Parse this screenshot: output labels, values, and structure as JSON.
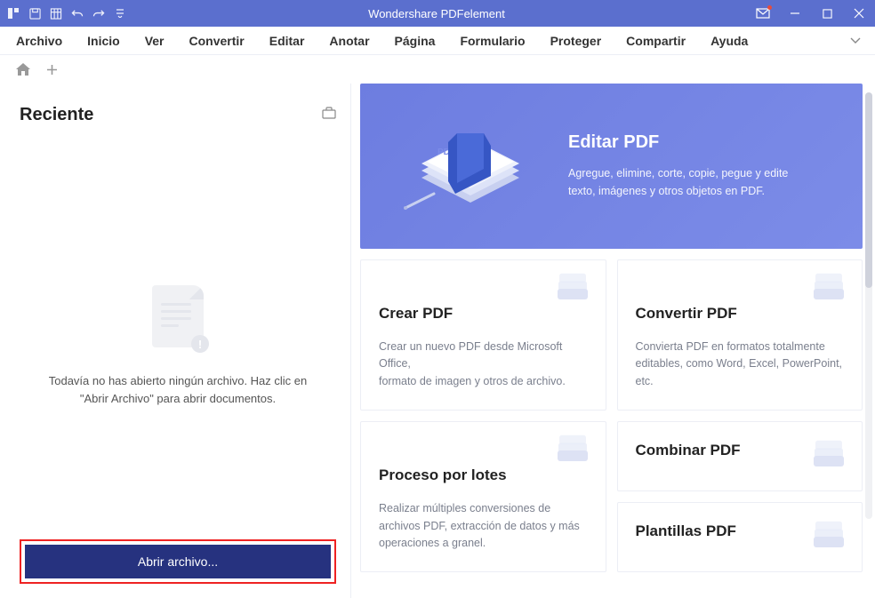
{
  "titlebar": {
    "title": "Wondershare PDFelement"
  },
  "menu": {
    "items": [
      "Archivo",
      "Inicio",
      "Ver",
      "Convertir",
      "Editar",
      "Anotar",
      "Página",
      "Formulario",
      "Proteger",
      "Compartir",
      "Ayuda"
    ]
  },
  "sidebar": {
    "recent_title": "Reciente",
    "empty_message": "Todavía no has abierto ningún archivo. Haz clic en \"Abrir Archivo\" para abrir documentos.",
    "open_button": "Abrir archivo..."
  },
  "hero": {
    "title": "Editar PDF",
    "desc": "Agregue, elimine, corte, copie, pegue y edite texto, imágenes y otros objetos en PDF."
  },
  "cards": {
    "create": {
      "title": "Crear PDF",
      "desc_l1": "Crear un nuevo PDF desde Microsoft Office,",
      "desc_l2": "formato de imagen y otros de archivo."
    },
    "convert": {
      "title": "Convertir PDF",
      "desc": "Convierta PDF en formatos totalmente editables, como Word, Excel, PowerPoint, etc."
    },
    "batch": {
      "title": "Proceso por lotes",
      "desc": "Realizar múltiples conversiones de archivos PDF, extracción de datos y más operaciones a granel."
    },
    "combine": {
      "title": "Combinar PDF"
    },
    "templates": {
      "title": "Plantillas PDF"
    }
  }
}
